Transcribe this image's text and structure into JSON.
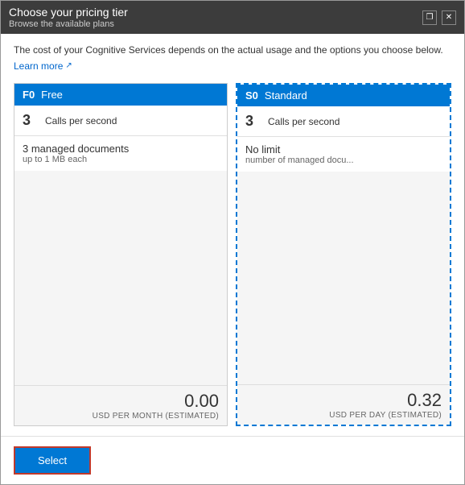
{
  "dialog": {
    "title": "Choose your pricing tier",
    "subtitle": "Browse the available plans",
    "controls": {
      "restore_label": "❐",
      "close_label": "✕"
    }
  },
  "description": {
    "main_text": "The cost of your Cognitive Services depends on the actual usage and the options you choose below.",
    "learn_more_label": "Learn more",
    "external_icon": "🔗"
  },
  "plans": [
    {
      "id": "F0",
      "name": "Free",
      "is_selected": false,
      "calls_per_second_num": "3",
      "calls_per_second_label": "Calls per second",
      "detail_main": "3 managed documents",
      "detail_sub": "up to 1 MB each",
      "price": "0.00",
      "price_unit": "USD PER MONTH (ESTIMATED)"
    },
    {
      "id": "S0",
      "name": "Standard",
      "is_selected": true,
      "calls_per_second_num": "3",
      "calls_per_second_label": "Calls per second",
      "detail_main": "No limit",
      "detail_sub": "number of managed docu...",
      "price": "0.32",
      "price_unit": "USD PER DAY (ESTIMATED)"
    }
  ],
  "footer": {
    "select_label": "Select"
  }
}
